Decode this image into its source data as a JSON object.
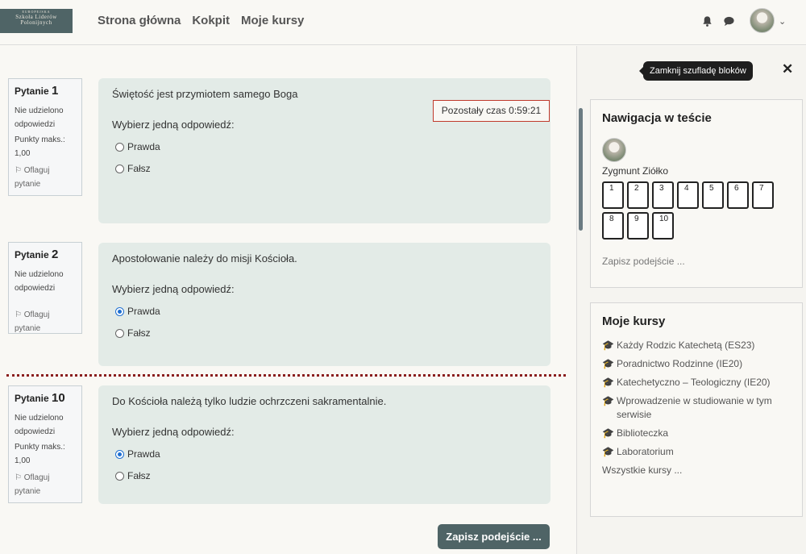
{
  "logo": {
    "line1": "Europejska",
    "line2": "Szkoła Liderów",
    "line3": "Polonijnych"
  },
  "nav": {
    "home": "Strona główna",
    "dashboard": "Kokpit",
    "my_courses": "Moje kursy"
  },
  "timer": "Pozostały czas 0:59:21",
  "questions": [
    {
      "label": "Pytanie",
      "num": "1",
      "state": "Nie udzielono odpowiedzi",
      "grade": "Punkty maks.: 1,00",
      "flag": "Oflaguj pytanie",
      "text": "Świętość jest przymiotem samego Boga",
      "prompt": "Wybierz jedną odpowiedź:",
      "answers": [
        "Prawda",
        "Fałsz"
      ],
      "selected": null
    },
    {
      "label": "Pytanie",
      "num": "2",
      "state": "Nie udzielono odpowiedzi",
      "grade": "",
      "flag": "Oflaguj pytanie",
      "text": "Apostołowanie należy do misji Kościoła.",
      "prompt": "Wybierz jedną odpowiedź:",
      "answers": [
        "Prawda",
        "Fałsz"
      ],
      "selected": "Prawda"
    },
    {
      "label": "Pytanie",
      "num": "10",
      "state": "Nie udzielono odpowiedzi",
      "grade": "Punkty maks.: 1,00",
      "flag": "Oflaguj pytanie",
      "text": "Do Kościoła należą tylko ludzie ochrzczeni sakramentalnie.",
      "prompt": "Wybierz jedną odpowiedź:",
      "answers": [
        "Prawda",
        "Fałsz"
      ],
      "selected": "Prawda"
    }
  ],
  "save_button": "Zapisz podejście ...",
  "drawer": {
    "tooltip": "Zamknij szufladę bloków",
    "quiz_nav": {
      "title": "Nawigacja w teście",
      "user": "Zygmunt Ziółko",
      "buttons": [
        "1",
        "2",
        "3",
        "4",
        "5",
        "6",
        "7",
        "8",
        "9",
        "10"
      ],
      "finish": "Zapisz podejście ..."
    },
    "my_courses": {
      "title": "Moje kursy",
      "items": [
        "Każdy Rodzic Katechetą (ES23)",
        "Poradnictwo Rodzinne (IE20)",
        "Katechetyczno – Teologiczny (IE20)",
        "Wprowadzenie w studiowanie w tym serwisie",
        "Biblioteczka",
        "Laboratorium"
      ],
      "all": "Wszystkie kursy ..."
    }
  },
  "colors": {
    "accent": "#4f6466",
    "question_bg": "#e3ebe7",
    "timer_border": "#c0392b",
    "separator": "#8a1e1e"
  },
  "icons": {
    "bell": "bell-icon",
    "chat": "chat-icon",
    "flag": "flag-icon",
    "course": "graduation-cap-icon",
    "close": "close-icon"
  }
}
